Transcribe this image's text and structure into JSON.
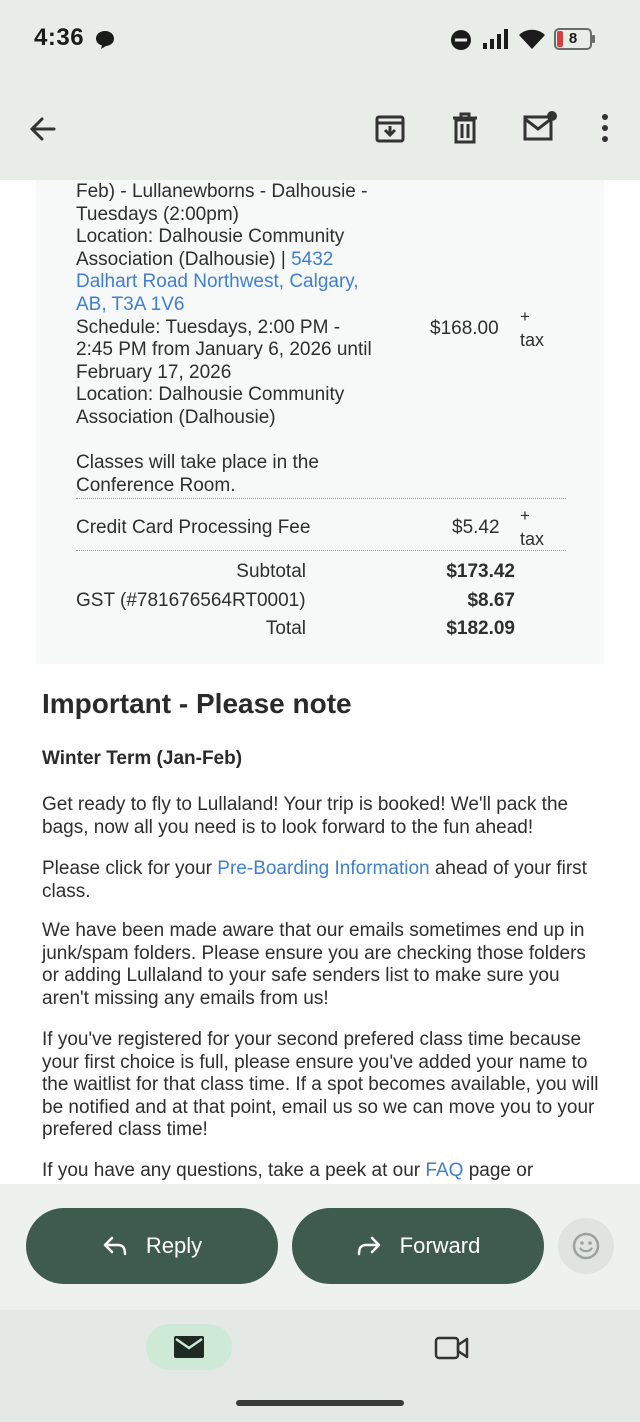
{
  "status_bar": {
    "time": "4:36",
    "battery": "8",
    "icons": [
      "chat-bubble-icon",
      "do-not-disturb-icon",
      "signal-icon",
      "wifi-icon",
      "battery-icon"
    ]
  },
  "app_bar": {
    "icons": [
      "back-arrow-icon",
      "archive-icon",
      "delete-icon",
      "mark-unread-icon",
      "more-vert-icon"
    ]
  },
  "order": {
    "item_lines": [
      "Feb) - Lullanewborns - Dalhousie -",
      "Tuesdays (2:00pm)",
      "Location: Dalhousie Community",
      "Association (Dalhousie) |"
    ],
    "address_link": [
      "5432",
      "Dalhart Road Northwest, Calgary,",
      "AB, T3A 1V6"
    ],
    "schedule_lines": [
      "Schedule: Tuesdays, 2:00 PM -",
      "2:45 PM from January 6, 2026 until",
      "February 17, 2026",
      "Location: Dalhousie Community",
      "Association (Dalhousie)"
    ],
    "room_lines": [
      "Classes will take place in the",
      "Conference Room."
    ],
    "item_price": "$168.00",
    "tax_plus": "+",
    "tax_word": "tax",
    "fee_label": "Credit Card Processing Fee",
    "fee_price": "$5.42",
    "subtotal_label": "Subtotal",
    "subtotal_value": "$173.42",
    "gst_label": "GST (#781676564RT0001)",
    "gst_value": "$8.67",
    "total_label": "Total",
    "total_value": "$182.09"
  },
  "notice": {
    "heading": "Important - Please note",
    "subheading": "Winter Term (Jan-Feb)",
    "p1": "Get ready to fly to Lullaland! Your trip is booked! We'll pack the bags, now all you need is to look forward to the fun ahead!",
    "p2_before": "Please click for your ",
    "p2_link": "Pre-Boarding Information",
    "p2_after": " ahead of your first class.",
    "p3": "We have been made aware that our emails sometimes end up in junk/spam folders. Please ensure you are checking those folders or adding Lullaland to your safe senders list to make sure you aren't missing any emails from us!",
    "p4": "If you've registered for your second prefered class time because your first choice is full, please ensure you've added your name to the waitlist for that class time. If a spot becomes available, you will be notified and at that point, email us so we can move you to your prefered class time!",
    "p5_before": "If you have any questions, take a peek at our ",
    "p5_link": "FAQ",
    "p5_after": " page or"
  },
  "actions": {
    "reply_label": "Reply",
    "forward_label": "Forward"
  },
  "nav": {
    "icons": [
      "mail-icon",
      "video-icon"
    ]
  }
}
